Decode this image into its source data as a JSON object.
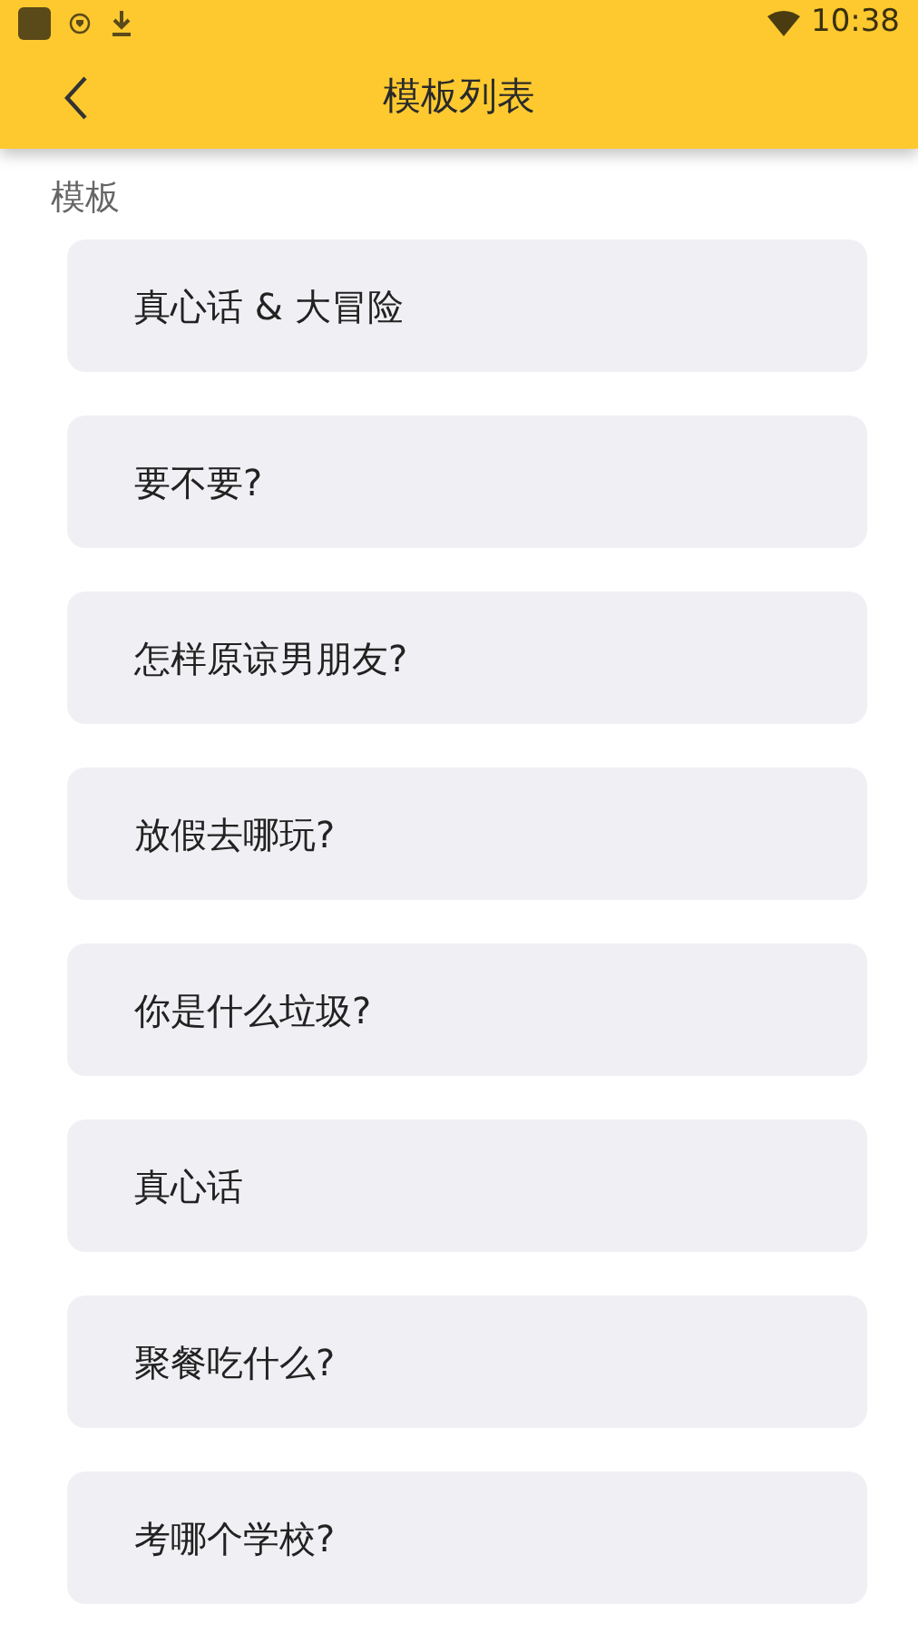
{
  "status_bar": {
    "time": "10:38"
  },
  "app_bar": {
    "title": "模板列表"
  },
  "section": {
    "label": "模板"
  },
  "items": [
    {
      "label": "真心话 & 大冒险"
    },
    {
      "label": "要不要?"
    },
    {
      "label": "怎样原谅男朋友?"
    },
    {
      "label": "放假去哪玩?"
    },
    {
      "label": "你是什么垃圾?"
    },
    {
      "label": "真心话"
    },
    {
      "label": "聚餐吃什么?"
    },
    {
      "label": "考哪个学校?"
    }
  ]
}
